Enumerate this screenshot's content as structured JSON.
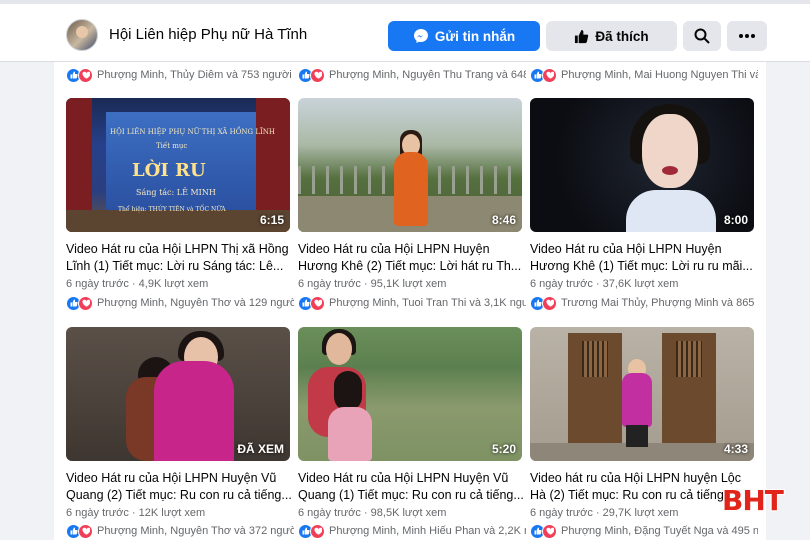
{
  "header": {
    "page_name": "Hội Liên hiệp Phụ nữ Hà Tĩnh",
    "message_button": "Gửi tin nhắn",
    "liked_button": "Đã thích",
    "search_icon": "search-icon",
    "more_icon": "more-icon",
    "colors": {
      "primary": "#1877f2",
      "secondary_button": "#e4e6eb"
    }
  },
  "top_reactions": [
    "Phượng Minh, Thủy Diễm và 753 người k",
    "Phượng Minh, Nguyễn Thu Trang và 648",
    "Phượng Minh, Mai Huong Nguyen Thi và"
  ],
  "videos": [
    {
      "duration": "6:15",
      "title1": "Video Hát ru của Hội LHPN Thị xã Hồng",
      "title2": "Lĩnh (1) Tiết mục: Lời ru Sáng tác: Lê...",
      "meta": "6 ngày trước · 4,9K lượt xem",
      "reactions": "Phượng Minh, Nguyễn Thơ và 129 người",
      "thumb": {
        "banner1": "HỘI LIÊN HIỆP PHỤ NỮ THỊ XÃ HỒNG LĨNH",
        "banner2": "Tiết mục",
        "banner3": "LỜI RU",
        "banner4": "Sáng tác: LÊ MINH",
        "banner5": "Thể hiện: THÚY TIÊN và TỐC NỮA"
      }
    },
    {
      "duration": "8:46",
      "title1": "Video Hát ru của Hội LHPN Huyện",
      "title2": "Hương Khê (2) Tiết mục: Lời hát ru Th...",
      "meta": "6 ngày trước · 95,1K lượt xem",
      "reactions": "Phượng Minh, Tuoi Tran Thi và 3,1K người"
    },
    {
      "duration": "8:00",
      "title1": "Video Hát ru của Hội LHPN Huyện",
      "title2": "Hương Khê (1) Tiết mục: Lời ru ru mãi...",
      "meta": "6 ngày trước · 37,6K lượt xem",
      "reactions": "Trương Mai Thủy, Phượng Minh và 865 n"
    },
    {
      "duration": "ĐÃ XEM",
      "title1": "Video Hát ru của Hội LHPN Huyện Vũ",
      "title2": "Quang (2) Tiết mục: Ru con ru cả tiếng...",
      "meta": "6 ngày trước · 12K lượt xem",
      "reactions": "Phượng Minh, Nguyễn Thơ và 372 người"
    },
    {
      "duration": "5:20",
      "title1": "Video Hát ru của Hội LHPN Huyện Vũ",
      "title2": "Quang (1) Tiết mục: Ru con ru cả tiếng...",
      "meta": "6 ngày trước · 98,5K lượt xem",
      "reactions": "Phượng Minh, Minh Hiếu Phan và 2,2K n"
    },
    {
      "duration": "4:33",
      "title1": "Video hát ru của Hội LHPN huyện Lộc",
      "title2": "Hà (2) Tiết mục: Ru con ru cả tiếng",
      "meta": "6 ngày trước · 29,7K lượt xem",
      "reactions": "Phượng Minh, Đặng Tuyết Nga và 495 n"
    }
  ],
  "watermark": "BHT"
}
